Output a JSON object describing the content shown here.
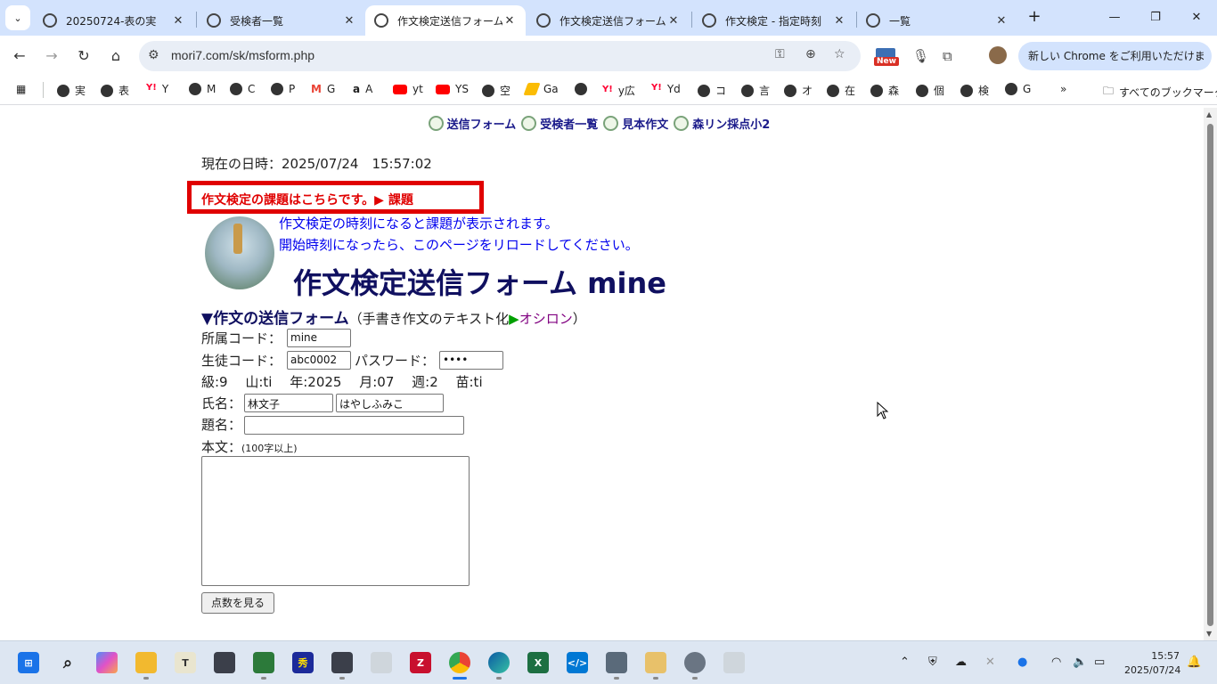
{
  "browser": {
    "tabs": [
      {
        "title": "20250724-表の実",
        "active": false
      },
      {
        "title": "受検者一覧",
        "active": false
      },
      {
        "title": "作文検定送信フォーム",
        "active": true
      },
      {
        "title": "作文検定送信フォーム",
        "active": false
      },
      {
        "title": "作文検定 - 指定時刻",
        "active": false
      },
      {
        "title": "一覧",
        "active": false
      }
    ],
    "close_glyph": "✕",
    "new_tab_glyph": "+",
    "url": "mori7.com/sk/msform.php",
    "new_badge": "New",
    "promo_text": "新しい Chrome をご利用いただけます",
    "promo_menu": "⋮"
  },
  "bookmarks": [
    {
      "label": "実",
      "kind": "globe"
    },
    {
      "label": "表",
      "kind": "globe"
    },
    {
      "label": "Y",
      "kind": "yahoo"
    },
    {
      "label": "M",
      "kind": "globe"
    },
    {
      "label": "C",
      "kind": "globe"
    },
    {
      "label": "P",
      "kind": "globe"
    },
    {
      "label": "G",
      "kind": "gmail"
    },
    {
      "label": "A",
      "kind": "amazon"
    },
    {
      "label": "yt",
      "kind": "yt"
    },
    {
      "label": "YS",
      "kind": "yt"
    },
    {
      "label": "空",
      "kind": "globe"
    },
    {
      "label": "Ga",
      "kind": "ads"
    },
    {
      "label": "",
      "kind": "globe"
    },
    {
      "label": "y広",
      "kind": "yahoo"
    },
    {
      "label": "Yd",
      "kind": "yahoo"
    },
    {
      "label": "コ",
      "kind": "globe"
    },
    {
      "label": "言",
      "kind": "globe"
    },
    {
      "label": "オ",
      "kind": "globe"
    },
    {
      "label": "在",
      "kind": "globe"
    },
    {
      "label": "森",
      "kind": "globe"
    },
    {
      "label": "個",
      "kind": "globe"
    },
    {
      "label": "検",
      "kind": "globe"
    },
    {
      "label": "G",
      "kind": "globe"
    }
  ],
  "bookmarks_more": "»",
  "all_bookmarks": "すべてのブックマーク",
  "page": {
    "nav": [
      "送信フォーム",
      "受検者一覧",
      "見本作文",
      "森リン採点小2"
    ],
    "datetime": "現在の日時：2025/07/24　15:57:02",
    "notice": "作文検定の課題はこちらです。▶ 課題",
    "message_line1": "作文検定の時刻になると課題が表示されます。",
    "message_line2": "開始時刻になったら、このページをリロードしてください。",
    "title": "作文検定送信フォーム mine",
    "form_header": {
      "heading": "▼作文の送信フォーム",
      "paren_open": "（手書き作文のテキスト化",
      "triangle": "▶",
      "link": "オシロン",
      "paren_close": "）"
    },
    "affiliation_label": "所属コード：",
    "affiliation_value": "mine",
    "student_label": "生徒コード：",
    "student_value": "abc0002",
    "password_label": "パスワード：",
    "password_value": "••••",
    "info_line": "級:9　 山:ti　 年:2025　 月:07　 週:2　 苗:ti",
    "name_label": "氏名：",
    "name_value": "林文子",
    "kana_value": "はやしふみこ",
    "subject_label": "題名：",
    "subject_value": "",
    "body_label": "本文：",
    "body_note": "(100字以上)",
    "submit_label": "点数を見る"
  },
  "taskbar": {
    "time": "15:57",
    "date": "2025/07/24"
  }
}
